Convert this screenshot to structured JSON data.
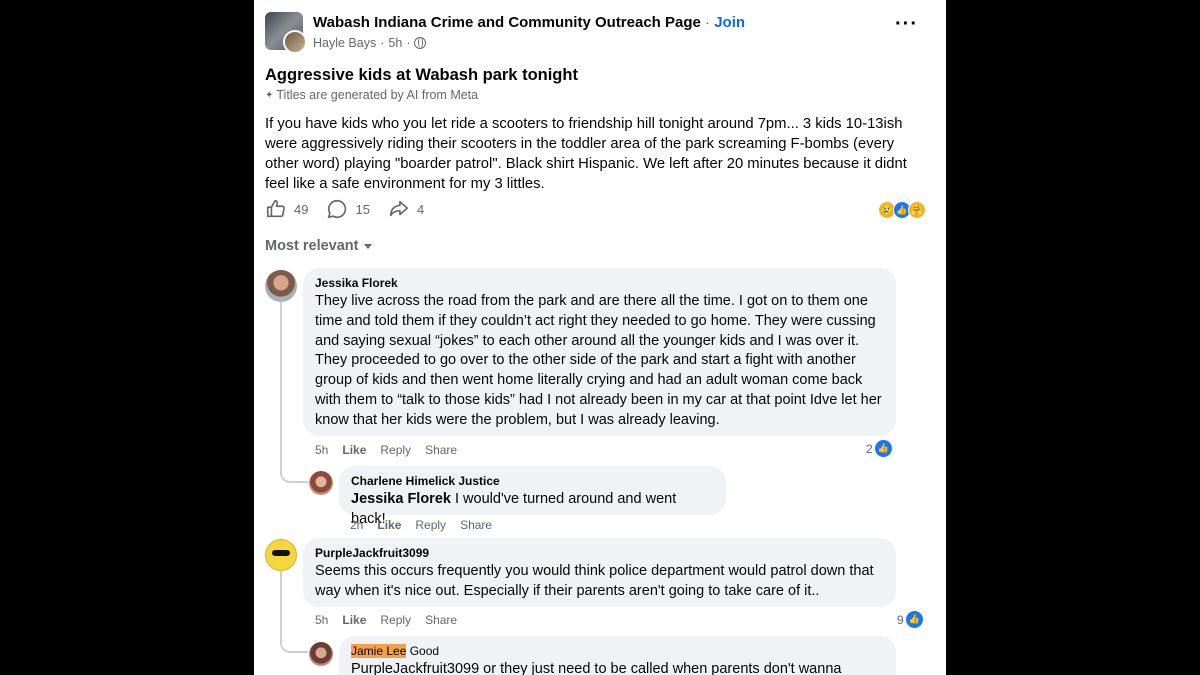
{
  "post": {
    "group_name": "Wabash Indiana Crime and Community Outreach Page",
    "join_label": "Join",
    "author": "Hayle Bays",
    "time": "5h",
    "title": "Aggressive kids at Wabash park tonight",
    "ai_note": "Titles are generated by AI from Meta",
    "body": "If you have kids who you let ride a scooters to friendship hill tonight around 7pm... 3 kids 10-13ish were aggressively riding their scooters in the toddler area of the park screaming F-bombs (every other word) playing \"boarder patrol\". Black shirt Hispanic. We left after 20 minutes because it didnt feel like a safe environment for my 3 littles.",
    "likes": "49",
    "comments": "15",
    "shares": "4"
  },
  "sort_label": "Most relevant",
  "comments": [
    {
      "name": "Jessika Florek",
      "text": "They live across the road from the park and are there all the time. I got on to them one time and told them if they couldn’t act right they needed to go home. They were cussing and saying sexual “jokes” to each other around all the younger kids and I was over it. They proceeded to go over to the other side of the park and start a fight with another group of kids and then went home literally crying and had an adult woman come back with them to “talk to those kids” had I not already been in my car at that point Idve let her know that her kids were the problem, but I was already leaving.",
      "time": "5h",
      "like": "Like",
      "reply": "Reply",
      "share": "Share",
      "reactions": "2"
    },
    {
      "name": "Charlene Himelick Justice",
      "mention": "Jessika Florek",
      "text": " I would've turned around and went back!",
      "time": "2h",
      "like": "Like",
      "reply": "Reply",
      "share": "Share"
    },
    {
      "name": "PurpleJackfruit3099",
      "text": "Seems this occurs frequently you would think police department would patrol down that way when it's nice out. Especially if their parents aren't going to take care of it..",
      "time": "5h",
      "like": "Like",
      "reply": "Reply",
      "share": "Share",
      "reactions": "9"
    },
    {
      "name": "Jamie Lee",
      "inline": "Good",
      "text": "PurpleJackfruit3099 or they just need to be called when parents don't wanna"
    }
  ],
  "colors": {
    "accent": "#0866ff",
    "bubble": "#f0f2f5",
    "muted": "#65676b",
    "highlight": "#f6a04a"
  }
}
